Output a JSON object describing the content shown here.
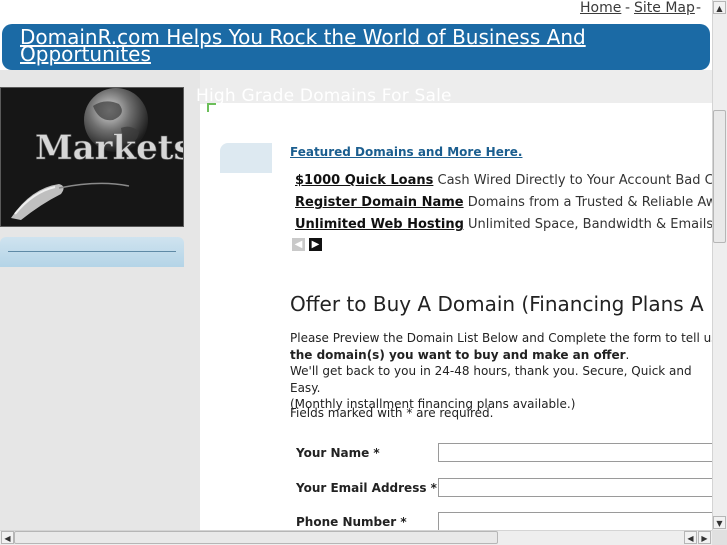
{
  "topnav": {
    "home": "Home",
    "sep": "-",
    "sitemap": "Site Map",
    "trail": "-"
  },
  "banner": {
    "title": "DomainR.com Helps You Rock the World of Business And Opportunites"
  },
  "sidebar": {
    "image_text": "Markets"
  },
  "main": {
    "header": "High Grade Domains For Sale",
    "featured_link": "Featured Domains and More Here.",
    "ads": [
      {
        "link": "$1000 Quick Loans",
        "text": "Cash Wired Directly to Your Account Bad Cre"
      },
      {
        "link": "Register Domain Name",
        "text": "Domains from a Trusted & Reliable Award"
      },
      {
        "link": "Unlimited Web Hosting",
        "text": "Unlimited Space, Bandwidth & Emails Fre"
      }
    ],
    "nav": {
      "prev_icon": "left-arrow",
      "next_icon": "right-arrow"
    },
    "offer_heading": "Offer to Buy A Domain (Financing Plans A",
    "intro": {
      "line1": "Please Preview the Domain List Below and Complete the form to tell us",
      "line2": "the domain(s) you want to buy and make an offer",
      "line2_end": ".",
      "line3": "We'll get back to you in 24-48 hours, thank you. Secure, Quick and Easy.",
      "line4": "(Monthly installment financing plans available.)"
    },
    "required_note": "Fields marked with * are required.",
    "form": {
      "name_label": "Your Name *",
      "email_label": "Your Email Address *",
      "phone_label": "Phone Number *",
      "name_value": "",
      "email_value": "",
      "phone_value": ""
    }
  },
  "colors": {
    "banner": "#1b6aa5",
    "link": "#1b5e8f",
    "sidebar": "#e6e6e6",
    "accent": "#6cbf5a"
  }
}
